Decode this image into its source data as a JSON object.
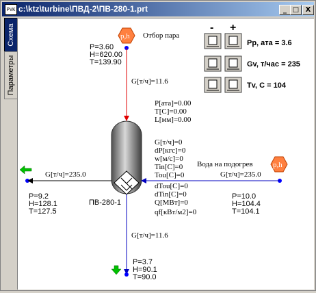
{
  "window": {
    "title": "c:\\ktz\\turbine\\ПВД-2\\ПВ-280-1.prt",
    "icon_text": "PVK",
    "buttons": {
      "minimize": "_",
      "maximize": "□",
      "close": "X"
    }
  },
  "tabs": [
    {
      "label": "Схема"
    },
    {
      "label": "Параметры"
    }
  ],
  "diagram": {
    "extraction": {
      "badge": "p,h",
      "label": "Отбор пара",
      "P": "P=3.60",
      "H": "H=620.00",
      "T": "T=139.90",
      "flow": "G[т/ч]=11.6"
    },
    "state": {
      "P": "P[ата]=0.00",
      "T": "T[C]=0.00",
      "L": "L[мм]=0.00"
    },
    "params": [
      "G[т/ч]=0",
      "dP[кгс]=0",
      "w[м/с]=0",
      "Tin[C]=0",
      "Tou[C]=0",
      "dTou[C]=0",
      "dTin[C]=0",
      "Q[МВт]=0",
      "qf[кВт/м2]=0"
    ],
    "heater_name": "ПВ-280-1",
    "water_in": {
      "badge": "p,h",
      "label": "Вода на подогрев",
      "flow": "G[т/ч]=235.0",
      "P": "P=10.0",
      "H": "H=104.4",
      "T": "T=104.1"
    },
    "water_out": {
      "flow": "G[т/ч]=235.0",
      "P": "P=9.2",
      "H": "H=128.1",
      "T": "T=127.5"
    },
    "drain": {
      "flow": "G[т/ч]=11.6",
      "P": "P=3.7",
      "H": "H=90.1",
      "T": "T=90.0"
    }
  },
  "controls": {
    "minus": "-",
    "plus": "+",
    "rows": [
      {
        "label": "Pp, ата = 3.6"
      },
      {
        "label": "Gv, т/час = 235"
      },
      {
        "label": "Tv, C = 104"
      }
    ]
  },
  "colors": {
    "steam_line": "#e00000",
    "water_line": "#0000c0",
    "node": "#0000ff",
    "badge": "#ff8040",
    "arrow_green": "#00c000"
  }
}
